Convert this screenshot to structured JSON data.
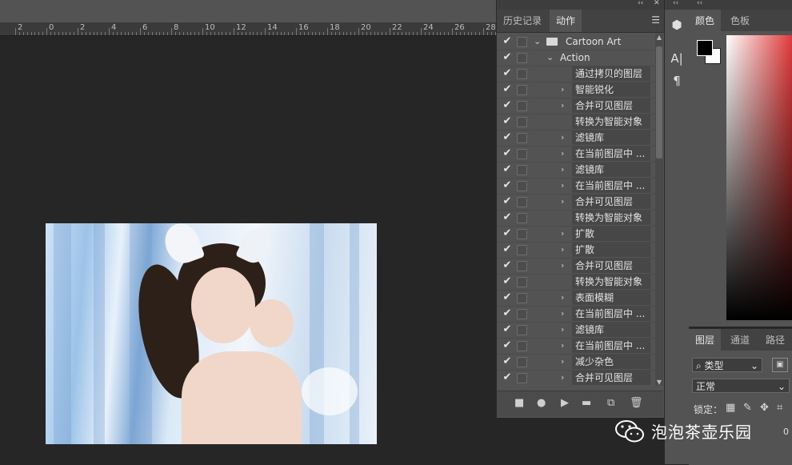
{
  "ruler": {
    "labels": [
      "2",
      "0",
      "2",
      "4",
      "6",
      "8",
      "10",
      "12",
      "14",
      "16",
      "18",
      "20",
      "22",
      "24",
      "26",
      "28"
    ]
  },
  "actions_panel": {
    "collapse_glyph": "‹‹",
    "close_glyph": "✕",
    "tabs": [
      {
        "label": "历史记录",
        "active": false
      },
      {
        "label": "动作",
        "active": true
      }
    ],
    "menu_icon": "hamburger-menu-icon",
    "set_name": "Cartoon Art",
    "action_name": "Action",
    "steps": [
      {
        "label": "通过拷贝的图层",
        "expandable": false
      },
      {
        "label": "智能锐化",
        "expandable": true
      },
      {
        "label": "合并可见图层",
        "expandable": true
      },
      {
        "label": "转换为智能对象",
        "expandable": false
      },
      {
        "label": "滤镜库",
        "expandable": true
      },
      {
        "label": "在当前图层中 ...",
        "expandable": true
      },
      {
        "label": "滤镜库",
        "expandable": true
      },
      {
        "label": "在当前图层中 ...",
        "expandable": true
      },
      {
        "label": "合并可见图层",
        "expandable": true
      },
      {
        "label": "转换为智能对象",
        "expandable": false
      },
      {
        "label": "扩散",
        "expandable": true
      },
      {
        "label": "扩散",
        "expandable": true
      },
      {
        "label": "合并可见图层",
        "expandable": true
      },
      {
        "label": "转换为智能对象",
        "expandable": false
      },
      {
        "label": "表面模糊",
        "expandable": true
      },
      {
        "label": "在当前图层中 ...",
        "expandable": true
      },
      {
        "label": "滤镜库",
        "expandable": true
      },
      {
        "label": "在当前图层中 ...",
        "expandable": true
      },
      {
        "label": "减少杂色",
        "expandable": true
      },
      {
        "label": "合并可见图层",
        "expandable": true
      }
    ],
    "bottom_icons": [
      "stop-icon",
      "record-icon",
      "play-icon",
      "new-set-icon",
      "new-action-icon",
      "trash-icon"
    ]
  },
  "color_panel": {
    "tabs": [
      {
        "label": "颜色",
        "active": true
      },
      {
        "label": "色板",
        "active": false
      }
    ],
    "foreground": "#000000",
    "background": "#ffffff"
  },
  "layers_panel": {
    "tabs": [
      {
        "label": "图层",
        "active": true
      },
      {
        "label": "通道",
        "active": false
      },
      {
        "label": "路径",
        "active": false
      }
    ],
    "filter_label": "类型",
    "blend_mode": "正常",
    "lock_label": "锁定：",
    "opacity_fragment": "0"
  },
  "watermark": {
    "text": "泡泡茶壶乐园"
  }
}
